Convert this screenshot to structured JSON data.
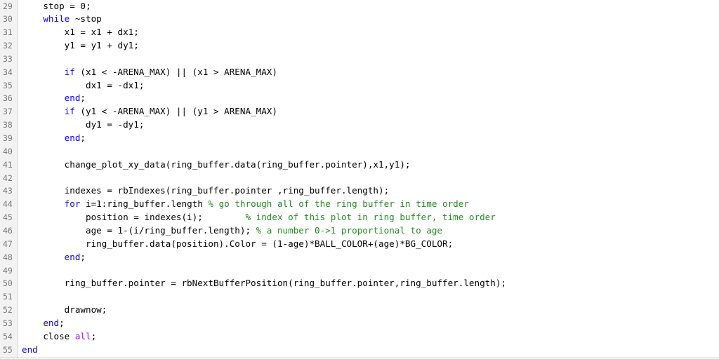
{
  "editor": {
    "colors": {
      "keyword": "#0e00ff",
      "comment": "#228b22",
      "string_keyword": "#a709f5",
      "default": "#000000",
      "gutter": "#f2f2f2",
      "line_number": "#7a7a7a"
    },
    "lines": [
      {
        "number": "29",
        "indent": "    ",
        "tokens": [
          {
            "t": "t",
            "v": "stop = 0;"
          }
        ]
      },
      {
        "number": "30",
        "indent": "    ",
        "tokens": [
          {
            "t": "kw",
            "v": "while"
          },
          {
            "t": "t",
            "v": " ~stop"
          }
        ]
      },
      {
        "number": "31",
        "indent": "        ",
        "tokens": [
          {
            "t": "t",
            "v": "x1 = x1 + dx1;"
          }
        ]
      },
      {
        "number": "32",
        "indent": "        ",
        "tokens": [
          {
            "t": "t",
            "v": "y1 = y1 + dy1;"
          }
        ]
      },
      {
        "number": "33",
        "indent": "",
        "tokens": []
      },
      {
        "number": "34",
        "indent": "        ",
        "tokens": [
          {
            "t": "kw",
            "v": "if"
          },
          {
            "t": "t",
            "v": " (x1 < -ARENA_MAX) || (x1 > ARENA_MAX)"
          }
        ]
      },
      {
        "number": "35",
        "indent": "            ",
        "tokens": [
          {
            "t": "t",
            "v": "dx1 = -dx1;"
          }
        ]
      },
      {
        "number": "36",
        "indent": "        ",
        "tokens": [
          {
            "t": "kw",
            "v": "end"
          },
          {
            "t": "t",
            "v": ";"
          }
        ]
      },
      {
        "number": "37",
        "indent": "        ",
        "tokens": [
          {
            "t": "kw",
            "v": "if"
          },
          {
            "t": "t",
            "v": " (y1 < -ARENA_MAX) || (y1 > ARENA_MAX)"
          }
        ]
      },
      {
        "number": "38",
        "indent": "            ",
        "tokens": [
          {
            "t": "t",
            "v": "dy1 = -dy1;"
          }
        ]
      },
      {
        "number": "39",
        "indent": "        ",
        "tokens": [
          {
            "t": "kw",
            "v": "end"
          },
          {
            "t": "t",
            "v": ";"
          }
        ]
      },
      {
        "number": "40",
        "indent": "",
        "tokens": []
      },
      {
        "number": "41",
        "indent": "        ",
        "tokens": [
          {
            "t": "t",
            "v": "change_plot_xy_data(ring_buffer.data(ring_buffer.pointer),x1,y1);"
          }
        ]
      },
      {
        "number": "42",
        "indent": "",
        "tokens": []
      },
      {
        "number": "43",
        "indent": "        ",
        "tokens": [
          {
            "t": "t",
            "v": "indexes = rbIndexes(ring_buffer.pointer ,ring_buffer.length);"
          }
        ]
      },
      {
        "number": "44",
        "indent": "        ",
        "tokens": [
          {
            "t": "kw",
            "v": "for"
          },
          {
            "t": "t",
            "v": " i=1:ring_buffer.length "
          },
          {
            "t": "cm",
            "v": "% go through all of the ring buffer in time order"
          }
        ]
      },
      {
        "number": "45",
        "indent": "            ",
        "tokens": [
          {
            "t": "t",
            "v": "position = indexes(i);        "
          },
          {
            "t": "cm",
            "v": "% index of this plot in ring buffer, time order"
          }
        ]
      },
      {
        "number": "46",
        "indent": "            ",
        "tokens": [
          {
            "t": "t",
            "v": "age = 1-(i/ring_buffer.length); "
          },
          {
            "t": "cm",
            "v": "% a number 0->1 proportional to age"
          }
        ]
      },
      {
        "number": "47",
        "indent": "            ",
        "tokens": [
          {
            "t": "t",
            "v": "ring_buffer.data(position).Color = (1-age)*BALL_COLOR+(age)*BG_COLOR;"
          }
        ]
      },
      {
        "number": "48",
        "indent": "        ",
        "tokens": [
          {
            "t": "kw",
            "v": "end"
          },
          {
            "t": "t",
            "v": ";"
          }
        ]
      },
      {
        "number": "49",
        "indent": "",
        "tokens": []
      },
      {
        "number": "50",
        "indent": "        ",
        "tokens": [
          {
            "t": "t",
            "v": "ring_buffer.pointer = rbNextBufferPosition(ring_buffer.pointer,ring_buffer.length);"
          }
        ]
      },
      {
        "number": "51",
        "indent": "",
        "tokens": []
      },
      {
        "number": "52",
        "indent": "        ",
        "tokens": [
          {
            "t": "t",
            "v": "drawnow;"
          }
        ]
      },
      {
        "number": "53",
        "indent": "    ",
        "tokens": [
          {
            "t": "kw",
            "v": "end"
          },
          {
            "t": "t",
            "v": ";"
          }
        ]
      },
      {
        "number": "54",
        "indent": "    ",
        "tokens": [
          {
            "t": "t",
            "v": "close "
          },
          {
            "t": "st",
            "v": "all"
          },
          {
            "t": "t",
            "v": ";"
          }
        ]
      },
      {
        "number": "55",
        "indent": "",
        "tokens": [
          {
            "t": "kw",
            "v": "end"
          }
        ]
      }
    ]
  }
}
